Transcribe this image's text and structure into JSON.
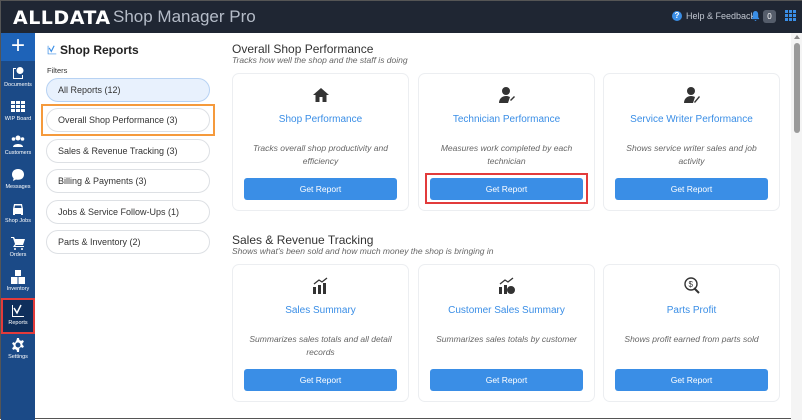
{
  "header": {
    "logo": "ALLDATA",
    "app_name": "Shop Manager Pro",
    "help": "Help & Feedback",
    "notifications": "0"
  },
  "sidebar": {
    "items": [
      {
        "label": "Documents"
      },
      {
        "label": "WIP Board"
      },
      {
        "label": "Customers"
      },
      {
        "label": "Messages"
      },
      {
        "label": "Shop Jobs"
      },
      {
        "label": "Orders"
      },
      {
        "label": "Inventory"
      },
      {
        "label": "Reports"
      },
      {
        "label": "Settings"
      }
    ]
  },
  "filters": {
    "title": "Shop Reports",
    "label": "Filters",
    "items": [
      "All Reports (12)",
      "Overall Shop Performance (3)",
      "Sales & Revenue Tracking (3)",
      "Billing & Payments (3)",
      "Jobs & Service Follow-Ups (1)",
      "Parts & Inventory (2)"
    ]
  },
  "sections": [
    {
      "title": "Overall Shop Performance",
      "subtitle": "Tracks how well the shop and the staff is doing",
      "cards": [
        {
          "title": "Shop Performance",
          "desc": "Tracks overall shop productivity and efficiency",
          "button": "Get Report",
          "icon": "home-icon"
        },
        {
          "title": "Technician Performance",
          "desc": "Measures work completed by each technician",
          "button": "Get Report",
          "icon": "technician-icon"
        },
        {
          "title": "Service Writer Performance",
          "desc": "Shows service writer sales and job activity",
          "button": "Get Report",
          "icon": "service-writer-icon"
        }
      ]
    },
    {
      "title": "Sales & Revenue Tracking",
      "subtitle": "Shows what's been sold and how much money the shop is bringing in",
      "cards": [
        {
          "title": "Sales Summary",
          "desc": "Summarizes sales totals and all detail records",
          "button": "Get Report",
          "icon": "bar-chart-up-icon"
        },
        {
          "title": "Customer Sales Summary",
          "desc": "Summarizes sales totals by customer",
          "button": "Get Report",
          "icon": "customer-chart-icon"
        },
        {
          "title": "Parts Profit",
          "desc": "Shows profit earned from parts sold",
          "button": "Get Report",
          "icon": "parts-profit-icon"
        }
      ]
    }
  ],
  "colors": {
    "accent": "#3a8ee6",
    "sidebar": "#1b4a87",
    "topbar": "#1f2633",
    "highlight_red": "#e23b3b",
    "highlight_orange": "#f59a3c"
  }
}
